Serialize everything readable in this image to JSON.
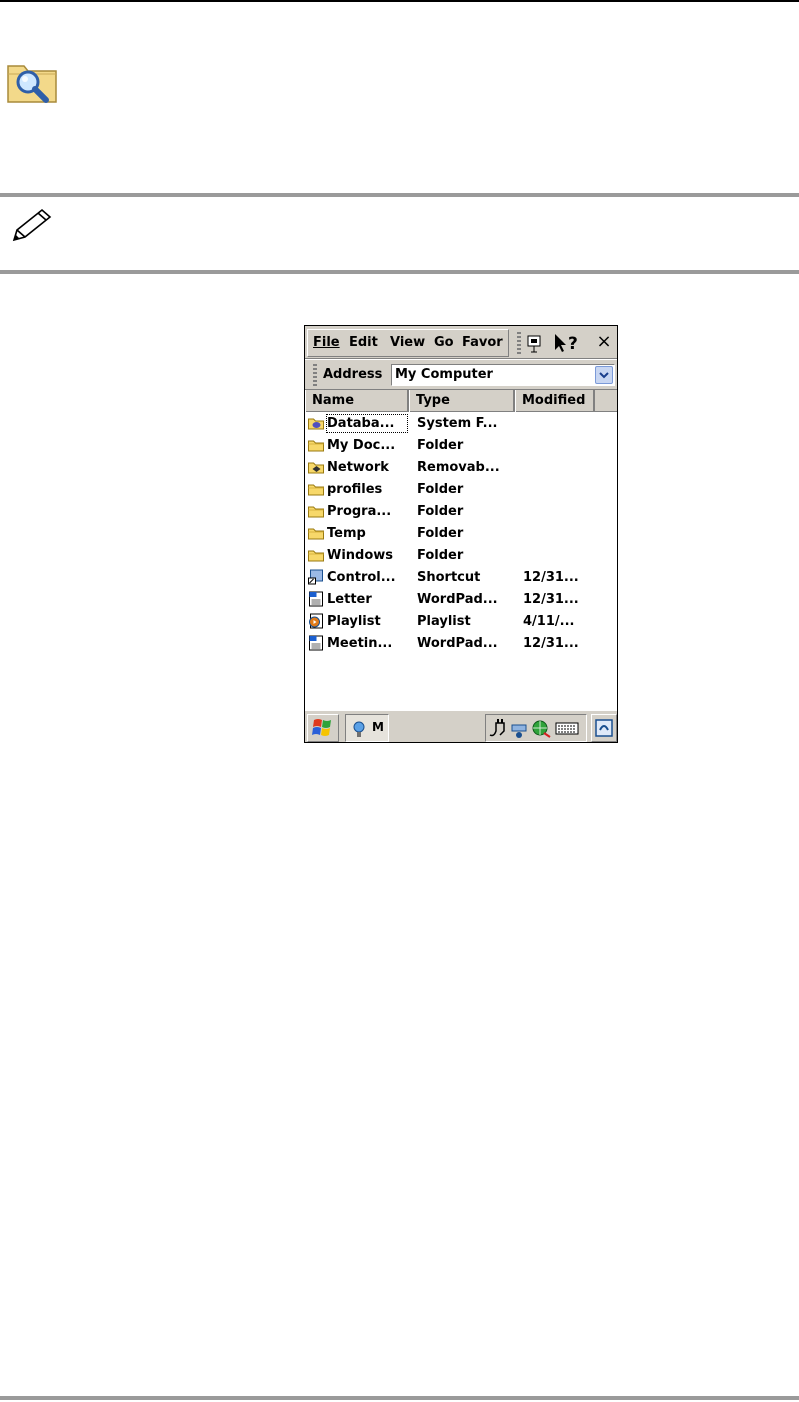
{
  "document": {
    "icons": [
      "search-folder-icon",
      "pencil-note-icon"
    ]
  },
  "device": {
    "menu": [
      "File",
      "Edit",
      "View",
      "Go",
      "Favor"
    ],
    "close_label": "×",
    "address": {
      "label": "Address",
      "value": "My Computer"
    },
    "columns": {
      "name": "Name",
      "type": "Type",
      "modified": "Modified"
    },
    "files": [
      {
        "name": "Databa...",
        "type": "System F...",
        "modified": "",
        "icon": "database-folder-icon"
      },
      {
        "name": "My Doc...",
        "type": "Folder",
        "modified": "",
        "icon": "folder-icon"
      },
      {
        "name": "Network",
        "type": "Removab...",
        "modified": "",
        "icon": "network-folder-icon"
      },
      {
        "name": "profiles",
        "type": "Folder",
        "modified": "",
        "icon": "folder-icon"
      },
      {
        "name": "Progra...",
        "type": "Folder",
        "modified": "",
        "icon": "folder-icon"
      },
      {
        "name": "Temp",
        "type": "Folder",
        "modified": "",
        "icon": "folder-icon"
      },
      {
        "name": "Windows",
        "type": "Folder",
        "modified": "",
        "icon": "folder-icon"
      },
      {
        "name": "Control...",
        "type": "Shortcut",
        "modified": "12/31...",
        "icon": "shortcut-icon"
      },
      {
        "name": "Letter",
        "type": "WordPad...",
        "modified": "12/31...",
        "icon": "wordpad-doc-icon"
      },
      {
        "name": "Playlist",
        "type": "Playlist",
        "modified": "4/11/...",
        "icon": "playlist-icon"
      },
      {
        "name": "Meetin...",
        "type": "WordPad...",
        "modified": "12/31...",
        "icon": "wordpad-doc-icon"
      }
    ],
    "taskbar": {
      "task_label": "M"
    }
  }
}
